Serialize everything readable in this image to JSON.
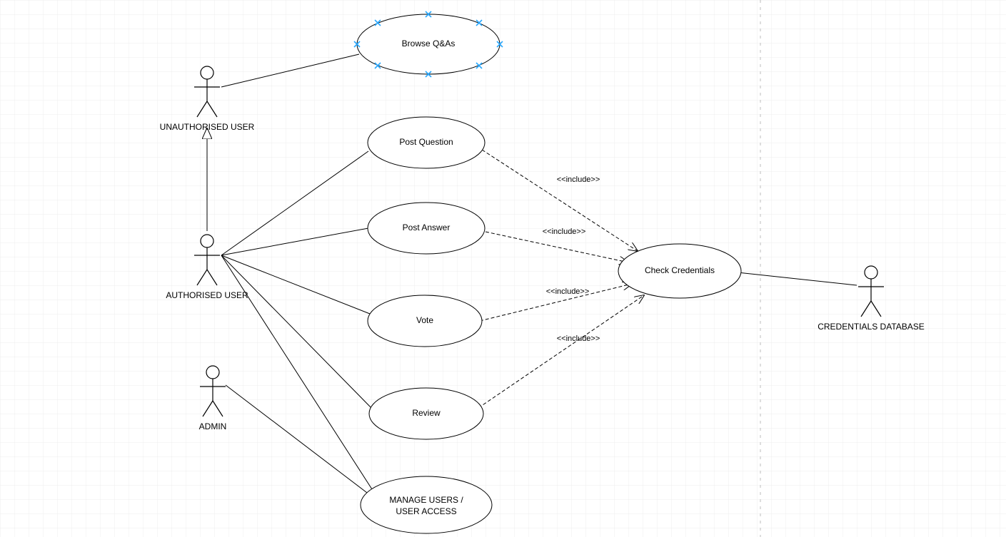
{
  "diagram": {
    "type": "uml-use-case",
    "actors": {
      "unauthorised": {
        "label": "UNAUTHORISED USER"
      },
      "authorised": {
        "label": "AUTHORISED USER"
      },
      "admin": {
        "label": "ADMIN"
      },
      "credsdb": {
        "label": "CREDENTIALS DATABASE"
      }
    },
    "usecases": {
      "browse": {
        "label": "Browse Q&As",
        "selected": true
      },
      "postQ": {
        "label": "Post Question"
      },
      "postA": {
        "label": "Post Answer"
      },
      "vote": {
        "label": "Vote"
      },
      "review": {
        "label": "Review"
      },
      "manage": {
        "label1": "MANAGE USERS /",
        "label2": "USER ACCESS"
      },
      "check": {
        "label": "Check Credentials"
      }
    },
    "includeLabel": "<<include>>",
    "relations": {
      "generalization": [
        {
          "child": "authorised",
          "parent": "unauthorised"
        }
      ],
      "associations": [
        {
          "actor": "unauthorised",
          "usecase": "browse"
        },
        {
          "actor": "authorised",
          "usecase": "postQ"
        },
        {
          "actor": "authorised",
          "usecase": "postA"
        },
        {
          "actor": "authorised",
          "usecase": "vote"
        },
        {
          "actor": "authorised",
          "usecase": "review"
        },
        {
          "actor": "authorised",
          "usecase": "manage"
        },
        {
          "actor": "admin",
          "usecase": "manage"
        },
        {
          "actor": "credsdb",
          "usecase": "check"
        }
      ],
      "includes": [
        {
          "from": "postQ",
          "to": "check"
        },
        {
          "from": "postA",
          "to": "check"
        },
        {
          "from": "vote",
          "to": "check"
        },
        {
          "from": "review",
          "to": "check"
        }
      ]
    }
  }
}
